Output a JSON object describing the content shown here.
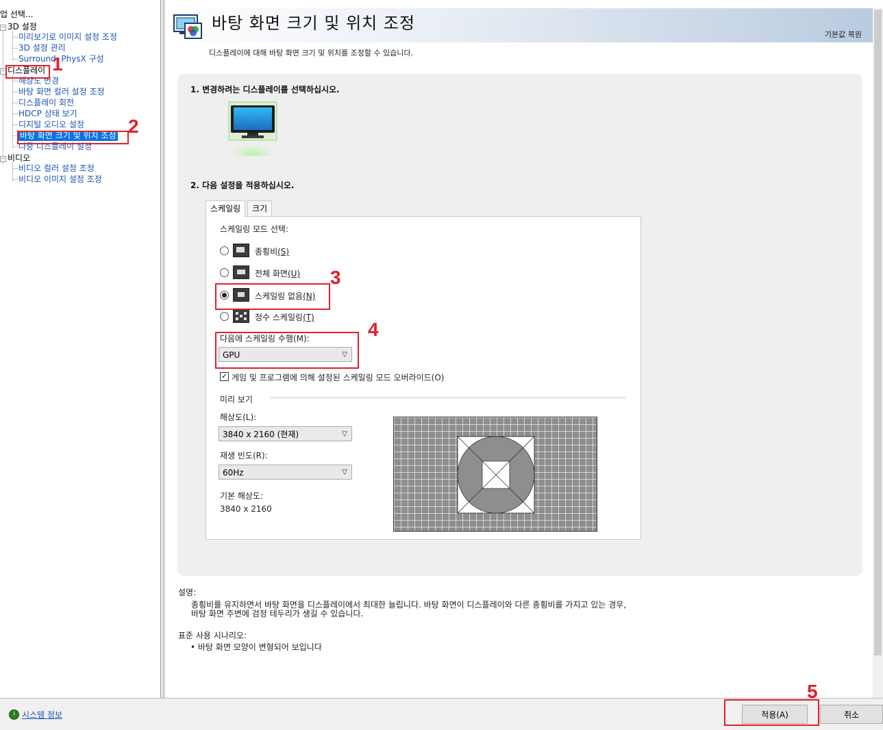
{
  "tree": {
    "header": "업 선택...",
    "categories": [
      {
        "label": "3D 설정",
        "items": [
          "미리보기로 이미지 설정 조정",
          "3D 설정 관리",
          "Surround, PhysX 구성"
        ]
      },
      {
        "label": "디스플레이",
        "items": [
          "해상도 변경",
          "바탕 화면 컬러 설정 조정",
          "디스플레이 회전",
          "HDCP 상태 보기",
          "디지털 오디오 설정",
          "바탕 화면 크기 및 위치 조정",
          "다중 디스플레이 설정"
        ]
      },
      {
        "label": "비디오",
        "items": [
          "비디오 컬러 설정 조정",
          "비디오 이미지 설정 조정"
        ]
      }
    ],
    "selected": "바탕 화면 크기 및 위치 조정"
  },
  "header": {
    "title": "바탕 화면 크기 및 위치 조정",
    "reset": "기본값 복원",
    "description": "디스플레이에 대해 바탕 화면 크기 및 위치를 조정할 수 있습니다."
  },
  "section1": {
    "title": "1. 변경하려는 디스플레이를 선택하십시오."
  },
  "section2": {
    "title": "2. 다음 설정을 적용하십시오."
  },
  "tabs": [
    "스케일링",
    "크기"
  ],
  "scaling": {
    "mode_label": "스케일링 모드 선택:",
    "options": [
      {
        "label": "종횡비",
        "key": "(S)",
        "selected": false
      },
      {
        "label": "전체 화면",
        "key": "(U)",
        "selected": false
      },
      {
        "label": "스케일링 없음",
        "key": "(N)",
        "selected": true
      },
      {
        "label": "정수 스케일링",
        "key": "(T)",
        "selected": false
      }
    ],
    "perform_label": "다음에 스케일링 수행(M):",
    "perform_value": "GPU",
    "override_label": "게임 및 프로그램에 의해 설정된 스케일링 모드 오버라이드(O)",
    "override_checked": true
  },
  "preview": {
    "group_label": "미리 보기",
    "resolution_label": "해상도(L):",
    "resolution_value": "3840 x 2160 (현재)",
    "refresh_label": "재생 빈도(R):",
    "refresh_value": "60Hz",
    "native_label": "기본 해상도:",
    "native_value": "3840 x 2160"
  },
  "explain": {
    "title": "설명:",
    "line1": "종횡비를 유지하면서 바탕 화면을 디스플레이에서 최대한 늘립니다. 바탕 화면이 디스플레이와 다른 종횡비를 가지고 있는 경우,",
    "line2": "바탕 화면 주변에 검정 테두리가 생길 수 있습니다."
  },
  "scenario": {
    "title": "표준 사용 시나리오:",
    "bullet": "• 바탕 화면 모양이 변형되어 보입니다"
  },
  "bottom": {
    "sysinfo": "시스템 정보",
    "apply": "적용(A)",
    "cancel": "취소"
  },
  "annotations": [
    "1",
    "2",
    "3",
    "4",
    "5"
  ],
  "colors": {
    "annotation_red": "#e0202a",
    "selection_blue": "#0b73e8",
    "link_blue": "#1a53b0"
  }
}
